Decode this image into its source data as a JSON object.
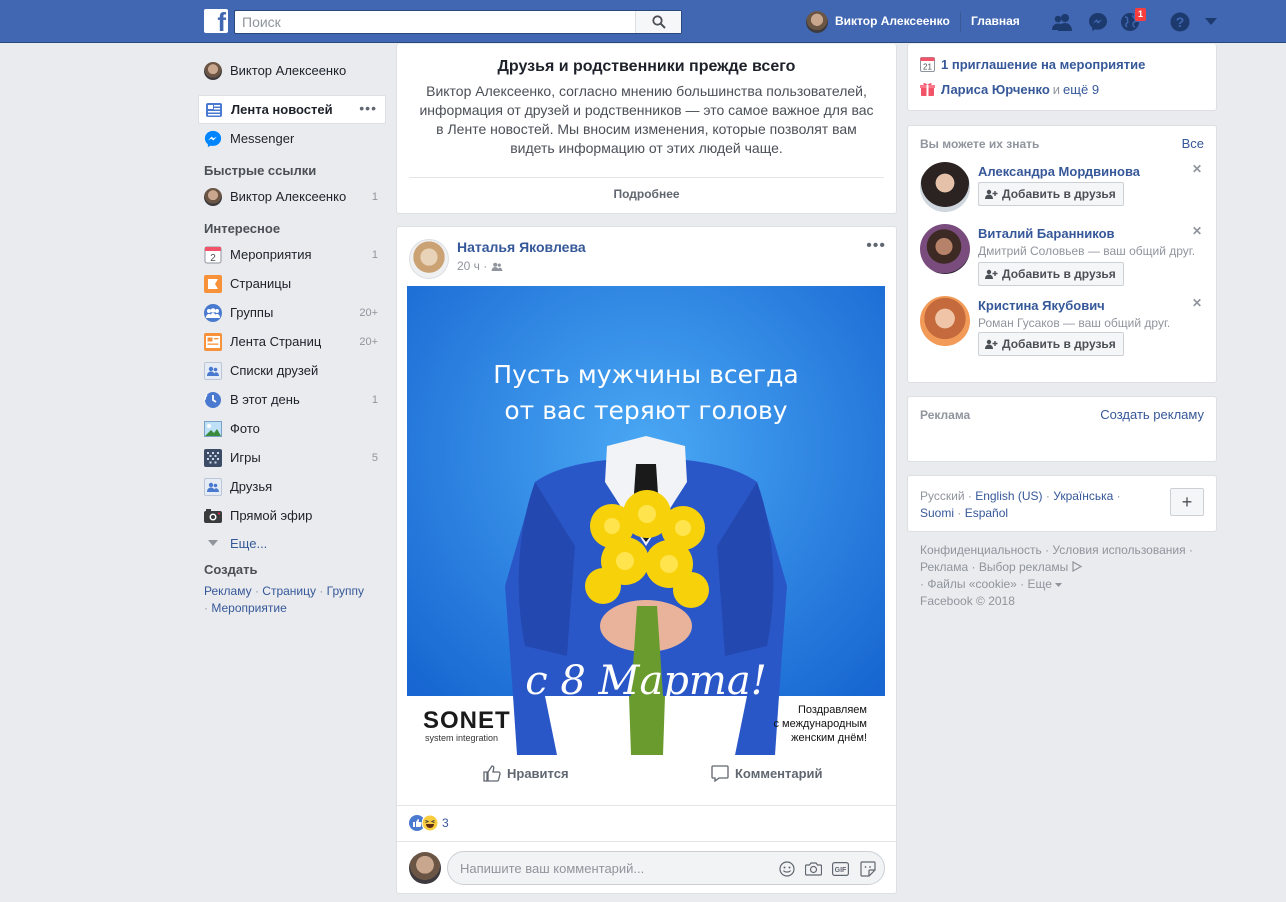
{
  "topbar": {
    "logo": "f",
    "search_placeholder": "Поиск",
    "user_name": "Виктор Алексеенко",
    "home_label": "Главная",
    "notifications_count": "1"
  },
  "leftnav": {
    "profile": "Виктор Алексеенко",
    "news_feed": "Лента новостей",
    "messenger": "Messenger",
    "quick_links_heading": "Быстрые ссылки",
    "quick_links": [
      {
        "label": "Виктор Алексеенко",
        "count": "1"
      }
    ],
    "explore_heading": "Интересное",
    "explore": [
      {
        "label": "Мероприятия",
        "count": "1",
        "icon": "calendar-icon"
      },
      {
        "label": "Страницы",
        "count": "",
        "icon": "flag-icon"
      },
      {
        "label": "Группы",
        "count": "20+",
        "icon": "groups-icon"
      },
      {
        "label": "Лента Страниц",
        "count": "20+",
        "icon": "pages-feed-icon"
      },
      {
        "label": "Списки друзей",
        "count": "",
        "icon": "friend-lists-icon"
      },
      {
        "label": "В этот день",
        "count": "1",
        "icon": "memories-icon"
      },
      {
        "label": "Фото",
        "count": "",
        "icon": "photo-icon"
      },
      {
        "label": "Игры",
        "count": "5",
        "icon": "games-icon"
      },
      {
        "label": "Друзья",
        "count": "",
        "icon": "friends-icon"
      },
      {
        "label": "Прямой эфир",
        "count": "",
        "icon": "live-icon"
      }
    ],
    "more": "Еще...",
    "create_heading": "Создать",
    "create_links": [
      "Рекламу",
      "Страницу",
      "Группу",
      "Мероприятие"
    ],
    "calendar_day": "2"
  },
  "info_card": {
    "title": "Друзья и родственники прежде всего",
    "body": "Виктор Алексеенко, согласно мнению большинства пользователей, информация от друзей и родственников — это самое важное для вас в Ленте новостей. Мы вносим изменения, которые позволят вам видеть информацию от этих людей чаще.",
    "more_link": "Подробнее"
  },
  "post": {
    "author": "Наталья Яковлева",
    "time": "20 ч",
    "image_text_line1": "Пусть мужчины всегда",
    "image_text_line2": "от вас теряют голову",
    "image_script": "с 8 Марта!",
    "brand": "SONET",
    "brand_sub": "system integration",
    "greeting_line1": "Поздравляем",
    "greeting_line2": "с международным",
    "greeting_line3": "женским днём!",
    "like_label": "Нравится",
    "comment_label": "Комментарий",
    "reactions_count": "3",
    "comment_placeholder": "Напишите ваш комментарий...",
    "gif_label": "GIF"
  },
  "right": {
    "events": {
      "calendar_day": "21",
      "invite_text": "1 приглашение на мероприятие",
      "birthday_name": "Лариса Юрченко",
      "and": "и",
      "more": "ещё 9"
    },
    "pymk": {
      "heading": "Вы можете их знать",
      "all": "Все",
      "add_label": "Добавить в друзья",
      "people": [
        {
          "name": "Александра Мордвинова",
          "mutual": ""
        },
        {
          "name": "Виталий Баранников",
          "mutual": "Дмитрий Соловьев — ваш общий друг."
        },
        {
          "name": "Кристина Якубович",
          "mutual": "Роман Гусаков — ваш общий друг."
        }
      ]
    },
    "ads": {
      "heading": "Реклама",
      "create": "Создать рекламу"
    },
    "languages": {
      "current": "Русский",
      "links": [
        "English (US)",
        "Українська",
        "Suomi",
        "Español"
      ],
      "plus": "+"
    },
    "footer": {
      "links": [
        "Конфиденциальность",
        "Условия использования",
        "Реклама",
        "Выбор рекламы",
        "Файлы «cookie»",
        "Еще"
      ],
      "copyright": "Facebook © 2018"
    }
  },
  "colors": {
    "brand": "#4267b2",
    "link": "#365899",
    "background": "#e9ebee",
    "badge": "#fa3e3e"
  }
}
